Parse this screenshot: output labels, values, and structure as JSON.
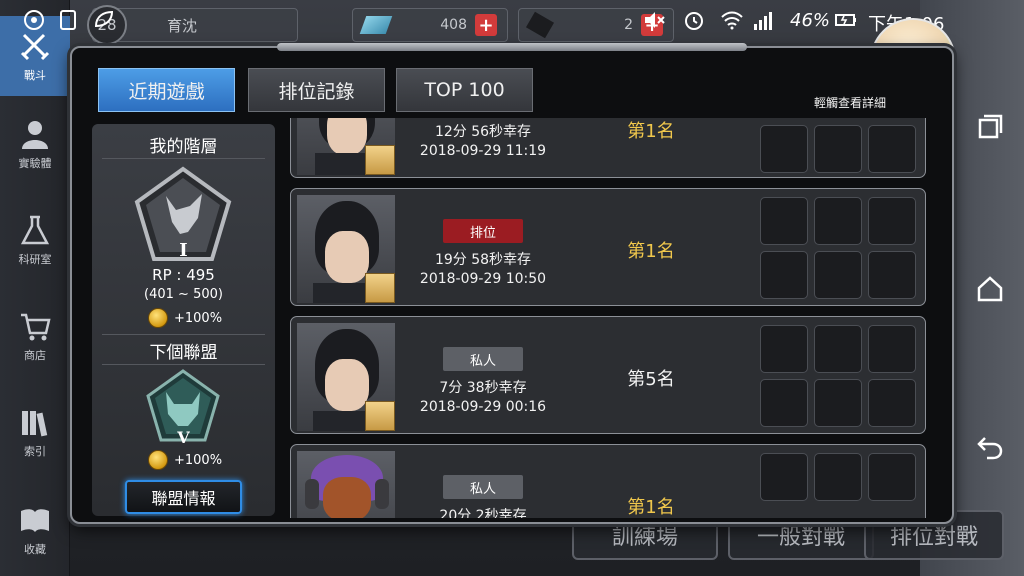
{
  "status": {
    "battery": "46%",
    "time": "下午1:06"
  },
  "topbar": {
    "level": "28",
    "name": "育沈",
    "gems": "408",
    "tickets": "2"
  },
  "rail": [
    {
      "label": "戰斗",
      "icon": "sword-icon",
      "active": true
    },
    {
      "label": "實驗體",
      "icon": "character-icon",
      "active": false
    },
    {
      "label": "科研室",
      "icon": "flask-icon",
      "active": false
    },
    {
      "label": "商店",
      "icon": "cart-icon",
      "active": false
    },
    {
      "label": "索引",
      "icon": "books-icon",
      "active": false
    },
    {
      "label": "收藏",
      "icon": "book-icon",
      "active": false
    }
  ],
  "background": {
    "bottom_buttons": [
      "訓練場",
      "一般對戰",
      "排位對戰"
    ]
  },
  "tabs": [
    "近期遊戲",
    "排位記錄",
    "TOP 100"
  ],
  "hint": "輕觸查看詳細",
  "rank": {
    "title": "我的階層",
    "tier": "I",
    "rp": "RP : 495",
    "range": "(401 ~ 500)",
    "bonus": "+100%",
    "next_title": "下個聯盟",
    "next_tier": "V",
    "next_bonus": "+100%",
    "button": "聯盟情報"
  },
  "matches": [
    {
      "mode": "",
      "survive": "12分 56秒幸存",
      "date": "2018-09-29 11:19",
      "place": "第1名"
    },
    {
      "mode": "排位",
      "survive": "19分 58秒幸存",
      "date": "2018-09-29 10:50",
      "place": "第1名"
    },
    {
      "mode": "私人",
      "survive": "7分 38秒幸存",
      "date": "2018-09-29 00:16",
      "place": "第5名"
    },
    {
      "mode": "私人",
      "survive": "20分 2秒幸存",
      "date": "",
      "place": "第1名"
    }
  ]
}
